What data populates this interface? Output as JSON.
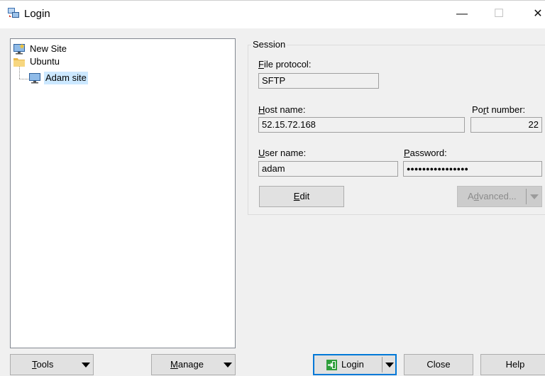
{
  "window": {
    "title": "Login",
    "minimize_glyph": "—",
    "maximize_glyph": "☐",
    "close_glyph": "✕"
  },
  "tree": {
    "items": [
      {
        "label": "New Site",
        "icon": "new-site-monitor-icon"
      },
      {
        "label": "Ubuntu",
        "icon": "folder-icon"
      },
      {
        "label": "Adam site",
        "icon": "site-monitor-icon",
        "selected": true
      }
    ]
  },
  "session": {
    "group_label": "Session",
    "file_protocol": {
      "label_key": "F",
      "label_rest": "ile protocol:",
      "value": "SFTP"
    },
    "host_name": {
      "label_key": "H",
      "label_rest": "ost name:",
      "value": "52.15.72.168"
    },
    "port_number": {
      "label_pre": "Po",
      "label_key": "r",
      "label_rest": "t number:",
      "value": "22"
    },
    "user_name": {
      "label_key": "U",
      "label_rest": "ser name:",
      "value": "adam"
    },
    "password": {
      "label_key": "P",
      "label_rest": "assword:",
      "value": "●●●●●●●●●●●●●●●●"
    },
    "edit_button": {
      "key": "E",
      "rest": "dit"
    },
    "advanced_button": {
      "pre": "A",
      "key": "d",
      "rest": "vanced..."
    }
  },
  "bottom": {
    "tools": {
      "key": "T",
      "rest": "ools"
    },
    "manage": {
      "key": "M",
      "rest": "anage"
    },
    "login": "Login",
    "close": "Close",
    "help": "Help"
  },
  "colors": {
    "selection": "#cce8ff",
    "accent": "#0078d7",
    "login_icon_green": "#2e9e3b"
  }
}
